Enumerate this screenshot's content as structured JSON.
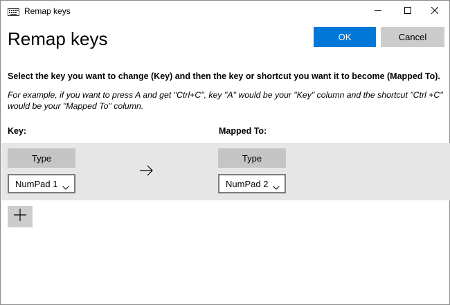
{
  "window": {
    "title": "Remap keys",
    "icon": "keyboard-icon",
    "controls": [
      "minimize-icon",
      "maximize-icon",
      "close-icon"
    ]
  },
  "page": {
    "title": "Remap keys",
    "ok_label": "OK",
    "cancel_label": "Cancel",
    "instruction": "Select the key you want to change (Key) and then the key or shortcut you want it to become (Mapped To).",
    "example": "For example, if you want to press A and get \"Ctrl+C\", key \"A\" would be your \"Key\" column and the shortcut \"Ctrl +C\" would be your \"Mapped To\" column."
  },
  "columns": {
    "key_header": "Key:",
    "mapped_header": "Mapped To:"
  },
  "mappings": [
    {
      "key_type_label": "Type",
      "key_value": "NumPad 1",
      "mapped_type_label": "Type",
      "mapped_value": "NumPad 2"
    }
  ],
  "add_button_icon": "plus-icon",
  "colors": {
    "accent": "#0078d7",
    "row_bg": "#e6e6e6",
    "button_gray": "#cccccc"
  }
}
